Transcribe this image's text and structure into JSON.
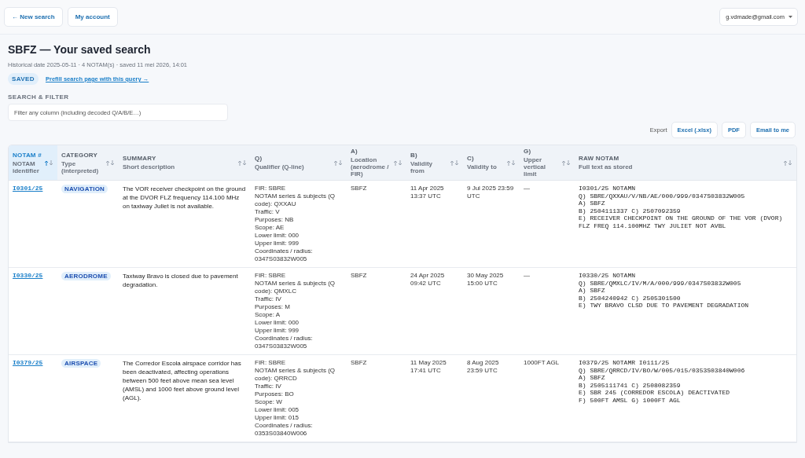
{
  "topbar": {
    "buttons": [
      "← New search",
      "My account"
    ],
    "account_menu": "g.vdmade@gmail.com"
  },
  "page": {
    "title": "SBFZ — Your saved search",
    "meta": "Historical date 2025-05-11 · 4 NOTAM(s) · saved 11 mei 2026, 14:01",
    "badge": "SAVED",
    "prefill_link": "Prefill search page with this query →"
  },
  "filter": {
    "label": "SEARCH & FILTER",
    "placeholder": "Filter any column (including decoded Q/A/B/E…)"
  },
  "export": {
    "label": "Export",
    "buttons": [
      "Excel (.xlsx)",
      "PDF",
      "Email to me"
    ]
  },
  "table": {
    "columns": [
      {
        "title": "NOTAM #",
        "subtitle": "NOTAM identifier",
        "selected": true
      },
      {
        "title": "CATEGORY",
        "subtitle": "Type (interpreted)",
        "selected": false
      },
      {
        "title": "SUMMARY",
        "subtitle": "Short description",
        "selected": false
      },
      {
        "title": "Q)",
        "subtitle": "Qualifier (Q-line)",
        "selected": false
      },
      {
        "title": "A)",
        "subtitle": "Location (aerodrome / FIR)",
        "selected": false
      },
      {
        "title": "B)",
        "subtitle": "Validity from",
        "selected": false
      },
      {
        "title": "C)",
        "subtitle": "Validity to",
        "selected": false
      },
      {
        "title": "G)",
        "subtitle": "Upper vertical limit",
        "selected": false
      },
      {
        "title": "RAW NOTAM",
        "subtitle": "Full text as stored",
        "selected": false
      }
    ],
    "rows": [
      {
        "id": "I0301/25",
        "category": "NAVIGATION",
        "summary": "The VOR receiver checkpoint on the ground at the DVOR FLZ frequency 114.100 MHz on taxiway Juliet is not available.",
        "qualifier": [
          "FIR: SBRE",
          "NOTAM series & subjects (Q code): QXXAU",
          "Traffic: V",
          "Purposes: NB",
          "Scope: AE",
          "Lower limit: 000",
          "Upper limit: 999",
          "Coordinates / radius: 0347S03832W005"
        ],
        "location": "SBFZ",
        "from": "11 Apr 2025 13:37 UTC",
        "to": "9 Jul 2025 23:59 UTC",
        "upper": "—",
        "raw": [
          "I0301/25 NOTAMN",
          "Q) SBRE/QXXAU/V/NB/AE/000/999/0347S03832W005",
          "A) SBFZ",
          "B) 2504111337 C) 2507092359",
          "E) RECEIVER CHECKPOINT ON THE GROUND OF THE VOR (DVOR) FLZ FREQ 114.100MHZ TWY JULIET NOT AVBL"
        ]
      },
      {
        "id": "I0330/25",
        "category": "AERODROME",
        "summary": "Taxiway Bravo is closed due to pavement degradation.",
        "qualifier": [
          "FIR: SBRE",
          "NOTAM series & subjects (Q code): QMXLC",
          "Traffic: IV",
          "Purposes: M",
          "Scope: A",
          "Lower limit: 000",
          "Upper limit: 999",
          "Coordinates / radius: 0347S03832W005"
        ],
        "location": "SBFZ",
        "from": "24 Apr 2025 09:42 UTC",
        "to": "30 May 2025 15:00 UTC",
        "upper": "—",
        "raw": [
          "I0330/25 NOTAMN",
          "Q) SBRE/QMXLC/IV/M/A/000/999/0347S03832W005",
          "A) SBFZ",
          "B) 2504240942 C) 2505301500",
          "E) TWY BRAVO CLSD DUE TO PAVEMENT DEGRADATION"
        ]
      },
      {
        "id": "I0379/25",
        "category": "AIRSPACE",
        "summary": "The Corredor Escola airspace corridor has been deactivated, affecting operations between 500 feet above mean sea level (AMSL) and 1000 feet above ground level (AGL).",
        "qualifier": [
          "FIR: SBRE",
          "NOTAM series & subjects (Q code): QRRCD",
          "Traffic: IV",
          "Purposes: BO",
          "Scope: W",
          "Lower limit: 005",
          "Upper limit: 015",
          "Coordinates / radius: 0353S03840W006"
        ],
        "location": "SBFZ",
        "from": "11 May 2025 17:41 UTC",
        "to": "8 Aug 2025 23:59 UTC",
        "upper": "1000FT AGL",
        "raw": [
          "I0379/25 NOTAMR I0111/25",
          "Q) SBRE/QRRCD/IV/BO/W/005/015/0353S03840W006",
          "A) SBFZ",
          "B) 2505111741 C) 2508082359",
          "E) SBR 245 (CORREDOR ESCOLA) DEACTIVATED",
          "F) 500FT AMSL G) 1000FT AGL"
        ]
      }
    ]
  }
}
